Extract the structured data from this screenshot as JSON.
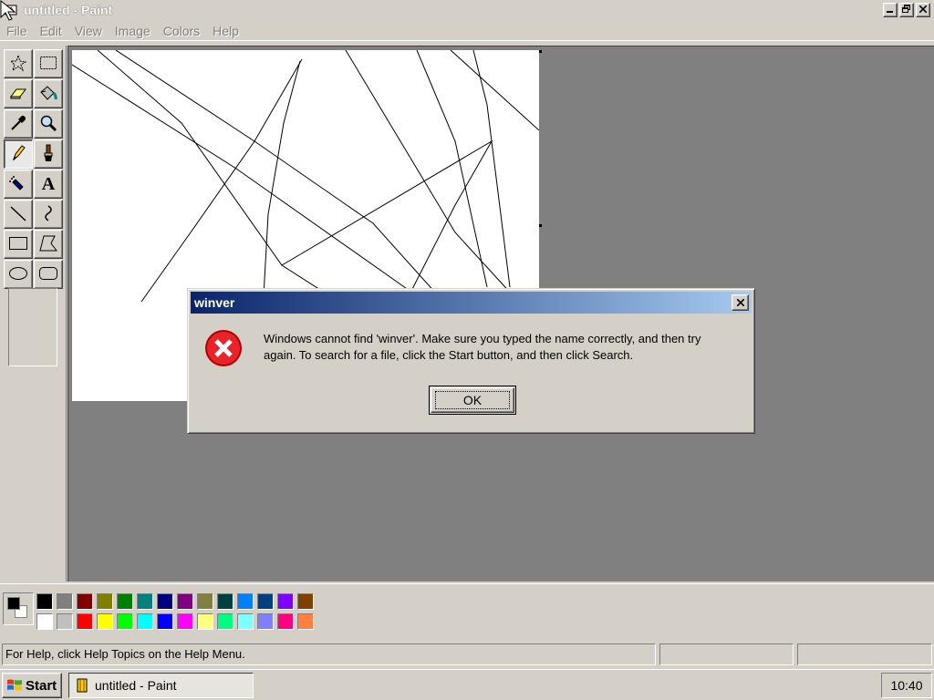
{
  "window": {
    "title": "untitled - Paint",
    "minimize_icon": "minimize-icon",
    "restore_icon": "restore-icon",
    "close_icon": "close-icon"
  },
  "menu": {
    "items": [
      "File",
      "Edit",
      "View",
      "Image",
      "Colors",
      "Help"
    ],
    "state": "disabled"
  },
  "toolbox": {
    "tools": [
      {
        "name": "free-form-select",
        "icon": "free-select-icon"
      },
      {
        "name": "select",
        "icon": "select-icon"
      },
      {
        "name": "eraser",
        "icon": "eraser-icon"
      },
      {
        "name": "fill-with-color",
        "icon": "fill-bucket-icon"
      },
      {
        "name": "pick-color",
        "icon": "eyedropper-icon"
      },
      {
        "name": "magnifier",
        "icon": "magnifier-icon"
      },
      {
        "name": "pencil",
        "icon": "pencil-icon",
        "active": true
      },
      {
        "name": "brush",
        "icon": "brush-icon"
      },
      {
        "name": "airbrush",
        "icon": "airbrush-icon"
      },
      {
        "name": "text",
        "icon": "text-icon"
      },
      {
        "name": "line",
        "icon": "line-icon"
      },
      {
        "name": "curve",
        "icon": "curve-icon"
      },
      {
        "name": "rectangle",
        "icon": "rectangle-icon"
      },
      {
        "name": "polygon",
        "icon": "polygon-icon"
      },
      {
        "name": "ellipse",
        "icon": "ellipse-icon"
      },
      {
        "name": "rounded-rectangle",
        "icon": "rounded-rectangle-icon"
      }
    ],
    "text_tool_glyph": "A"
  },
  "palette": {
    "foreground": "#000000",
    "background": "#ffffff",
    "colors_top": [
      "#000000",
      "#808080",
      "#800000",
      "#808000",
      "#008000",
      "#008080",
      "#000080",
      "#800080",
      "#808040",
      "#004040",
      "#0080ff",
      "#004080",
      "#8000ff",
      "#804000"
    ],
    "colors_bottom": [
      "#ffffff",
      "#c0c0c0",
      "#ff0000",
      "#ffff00",
      "#00ff00",
      "#00ffff",
      "#0000ff",
      "#ff00ff",
      "#ffff80",
      "#00ff80",
      "#80ffff",
      "#8080ff",
      "#ff0080",
      "#ff8040"
    ]
  },
  "statusbar": {
    "help_text": "For Help, click Help Topics on the Help Menu.",
    "coords": "",
    "size": ""
  },
  "dialog": {
    "title": "winver",
    "message_line1": "Windows cannot find 'winver'. Make sure you typed the name correctly, and then try",
    "message_line2": "again. To search for a file, click the Start button, and then click Search.",
    "ok_label": "OK",
    "icon": "error-icon",
    "close_icon": "close-icon"
  },
  "taskbar": {
    "start_label": "Start",
    "task_label": "untitled - Paint",
    "clock": "10:40"
  },
  "canvas": {
    "drawing": "freehand black pencil lines"
  }
}
